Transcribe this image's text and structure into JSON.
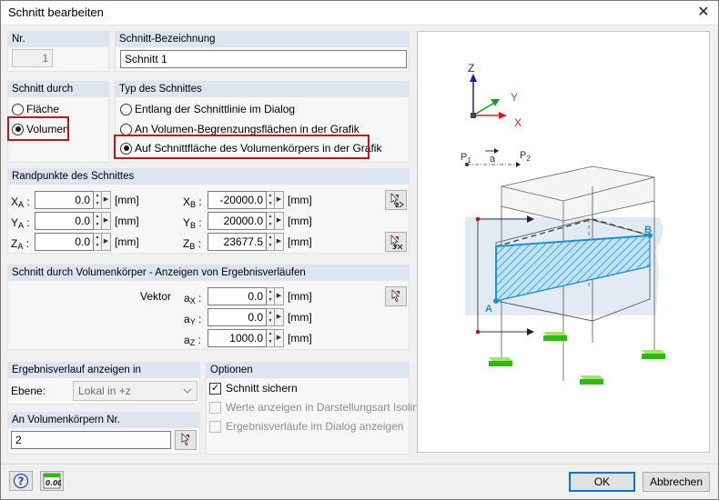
{
  "window": {
    "title": "Schnitt bearbeiten",
    "close_glyph": "✕"
  },
  "nr": {
    "header": "Nr.",
    "value": "1"
  },
  "bezeichnung": {
    "header": "Schnitt-Bezeichnung",
    "value": "Schnitt 1"
  },
  "schnitt_durch": {
    "header": "Schnitt durch",
    "options": [
      {
        "label": "Fläche",
        "selected": false
      },
      {
        "label": "Volumen",
        "selected": true
      }
    ]
  },
  "typ": {
    "header": "Typ des Schnittes",
    "options": [
      {
        "label": "Entlang der Schnittlinie im Dialog",
        "selected": false
      },
      {
        "label": "An Volumen-Begrenzungsflächen in der Grafik",
        "selected": false
      },
      {
        "label": "Auf Schnittfläche des Volumenkörpers in der Grafik",
        "selected": true
      }
    ]
  },
  "randpunkte": {
    "header": "Randpunkte des Schnittes",
    "unit": "[mm]",
    "xa": {
      "name": "X",
      "sub": "A",
      "value": "0.0"
    },
    "ya": {
      "name": "Y",
      "sub": "A",
      "value": "0.0"
    },
    "za": {
      "name": "Z",
      "sub": "A",
      "value": "0.0"
    },
    "xb": {
      "name": "X",
      "sub": "B",
      "value": "-20000.0"
    },
    "yb": {
      "name": "Y",
      "sub": "B",
      "value": "20000.0"
    },
    "zb": {
      "name": "Z",
      "sub": "B",
      "value": "23677.5"
    }
  },
  "volumen": {
    "header": "Schnitt durch Volumenkörper - Anzeigen von Ergebnisverläufen",
    "vektor_label": "Vektor",
    "unit": "[mm]",
    "ax": {
      "name": "a",
      "sub": "X",
      "value": "0.0"
    },
    "ay": {
      "name": "a",
      "sub": "Y",
      "value": "0.0"
    },
    "az": {
      "name": "a",
      "sub": "Z",
      "value": "1000.0"
    }
  },
  "ergebnis": {
    "header": "Ergebnisverlauf anzeigen in",
    "ebene_label": "Ebene:",
    "ebene_value": "Lokal in +z"
  },
  "volnr": {
    "header": "An Volumenkörpern Nr.",
    "value": "2"
  },
  "optionen": {
    "header": "Optionen",
    "items": [
      {
        "label": "Schnitt sichern",
        "checked": true,
        "disabled": false
      },
      {
        "label": "Werte anzeigen in Darstellungsart Isolinien",
        "checked": false,
        "disabled": true
      },
      {
        "label": "Ergebnisverläufe im Dialog anzeigen",
        "checked": false,
        "disabled": true
      }
    ]
  },
  "preview": {
    "axis_z": "Z",
    "axis_y": "Y",
    "axis_x": "X",
    "p1": "P",
    "p1_sub": "1",
    "p2": "P",
    "p2_sub": "2",
    "a": "a",
    "point_a": "A",
    "point_b": "B"
  },
  "buttons": {
    "ok": "OK",
    "cancel": "Abbrechen",
    "calc_icon_text": "0.00"
  },
  "colors": {
    "accent_blue": "#0078d7",
    "highlight_red": "#c1141e",
    "plane_blue": "#1e8fd2",
    "support_green": "#35c21b"
  }
}
